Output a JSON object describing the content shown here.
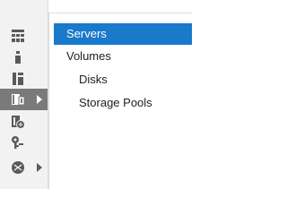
{
  "rail": {
    "items": [
      {
        "icon": "dashboard-icon",
        "selected": false,
        "expandable": false
      },
      {
        "icon": "local-server-icon",
        "selected": false,
        "expandable": false
      },
      {
        "icon": "all-servers-icon",
        "selected": false,
        "expandable": false
      },
      {
        "icon": "file-storage-services-icon",
        "selected": true,
        "expandable": true
      },
      {
        "icon": "iis-icon",
        "selected": false,
        "expandable": false
      },
      {
        "icon": "key-management-icon",
        "selected": false,
        "expandable": false
      },
      {
        "icon": "network-services-icon",
        "selected": false,
        "expandable": true
      }
    ]
  },
  "tree": {
    "servers": "Servers",
    "volumes": "Volumes",
    "disks": "Disks",
    "storage_pools": "Storage Pools"
  },
  "colors": {
    "selection": "#1979ca",
    "rail_selected": "#7a7a7a",
    "rail_background": "#f2f2f2"
  }
}
